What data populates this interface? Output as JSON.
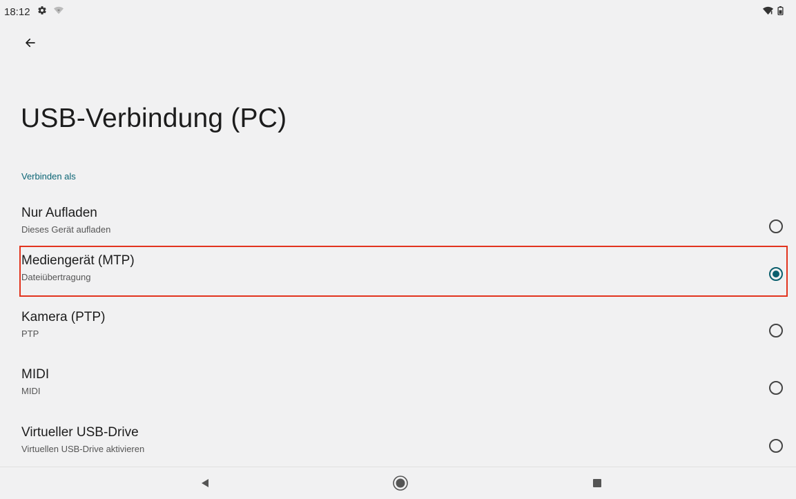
{
  "status_bar": {
    "time": "18:12",
    "icons_left": [
      "settings-icon",
      "wifi-weak-icon"
    ],
    "icons_right": [
      "wifi-icon",
      "battery-icon"
    ]
  },
  "header": {
    "back_icon": "arrow-left-icon",
    "title": "USB-Verbindung (PC)"
  },
  "section": {
    "label": "Verbinden als"
  },
  "options": [
    {
      "title": "Nur Aufladen",
      "subtitle": "Dieses Gerät aufladen",
      "selected": false
    },
    {
      "title": "Mediengerät (MTP)",
      "subtitle": "Dateiübertragung",
      "selected": true
    },
    {
      "title": "Kamera (PTP)",
      "subtitle": "PTP",
      "selected": false
    },
    {
      "title": "MIDI",
      "subtitle": "MIDI",
      "selected": false
    },
    {
      "title": "Virtueller USB-Drive",
      "subtitle": "Virtuellen USB-Drive aktivieren",
      "selected": false
    }
  ],
  "nav_bar": {
    "buttons": [
      "back-triangle-icon",
      "home-circle-icon",
      "recents-square-icon"
    ]
  },
  "colors": {
    "accent": "#0b5f6d",
    "highlight": "#e2331d",
    "background": "#f1f1f2"
  }
}
